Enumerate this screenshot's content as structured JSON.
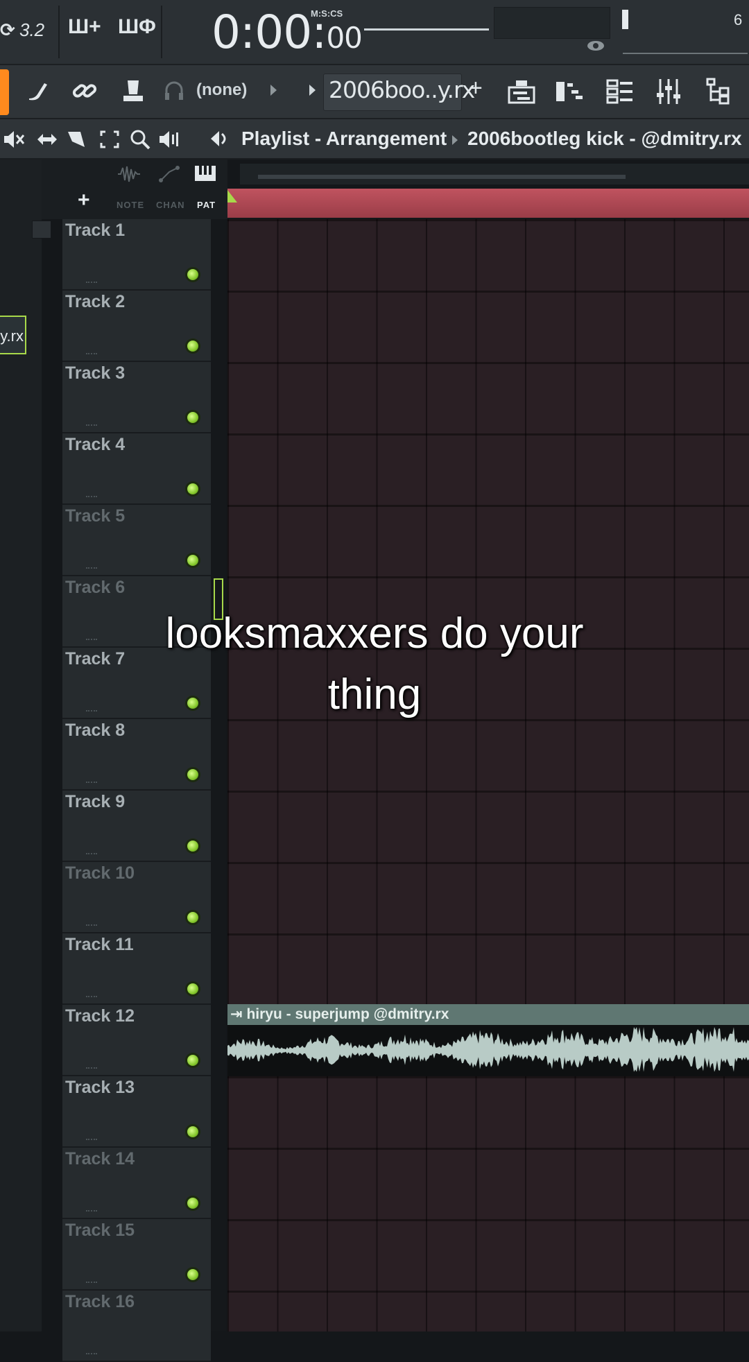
{
  "topbar": {
    "btn_32": "3.2",
    "time_main": "0:00:",
    "time_small": "00",
    "time_format": "M:S:CS",
    "corner_number": "6"
  },
  "toolbar2": {
    "channel_filter": "(none)",
    "pattern_name": "2006boo..y.rx",
    "add_label": "+"
  },
  "playlist": {
    "window_title": "Playlist - Arrangement",
    "current_item": "2006bootleg kick -  @dmitry.rx",
    "header_add": "+",
    "header_labels": [
      "NOTE",
      "CHAN",
      "PAT"
    ]
  },
  "browser": {
    "tab_label": "y.rx"
  },
  "tracks": [
    {
      "name": "Track 1"
    },
    {
      "name": "Track 2"
    },
    {
      "name": "Track 3"
    },
    {
      "name": "Track 4"
    },
    {
      "name": "Track 5"
    },
    {
      "name": "Track 6"
    },
    {
      "name": "Track 7"
    },
    {
      "name": "Track 8"
    },
    {
      "name": "Track 9"
    },
    {
      "name": "Track 10"
    },
    {
      "name": "Track 11"
    },
    {
      "name": "Track 12"
    },
    {
      "name": "Track 13"
    },
    {
      "name": "Track 14"
    },
    {
      "name": "Track 15"
    },
    {
      "name": "Track 16"
    }
  ],
  "clip": {
    "title": "hiryu - superjump @dmitry.rx",
    "track": "Track 12"
  },
  "caption": {
    "line1": "looksmaxxers do your",
    "line2": "thing"
  },
  "colors": {
    "accent_green": "#a8d94a",
    "timeline_red": "#b44a56",
    "clip_header": "#5f7772",
    "orange_tab": "#ff8a1e"
  }
}
